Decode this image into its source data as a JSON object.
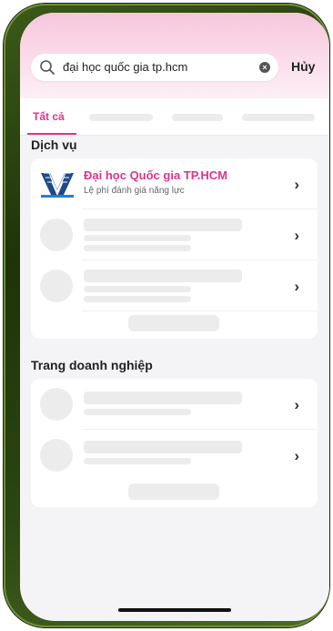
{
  "search": {
    "value": "đại học quốc gia tp.hcm",
    "clear_icon": "×",
    "cancel_label": "Hủy"
  },
  "tabs": {
    "active_label": "Tất cả"
  },
  "sections": {
    "services": {
      "title": "Dịch vụ",
      "first_item": {
        "title": "Đại học Quốc gia TP.HCM",
        "subtitle": "Lệ phí đánh giá năng lực"
      }
    },
    "business": {
      "title": "Trang doanh nghiệp"
    }
  },
  "icons": {
    "chevron": "›"
  },
  "colors": {
    "accent": "#e0338a",
    "header_gradient_top": "#f7c6dc",
    "skeleton": "#ececec",
    "background": "#f4f4f6",
    "frame": "#2b4611"
  }
}
